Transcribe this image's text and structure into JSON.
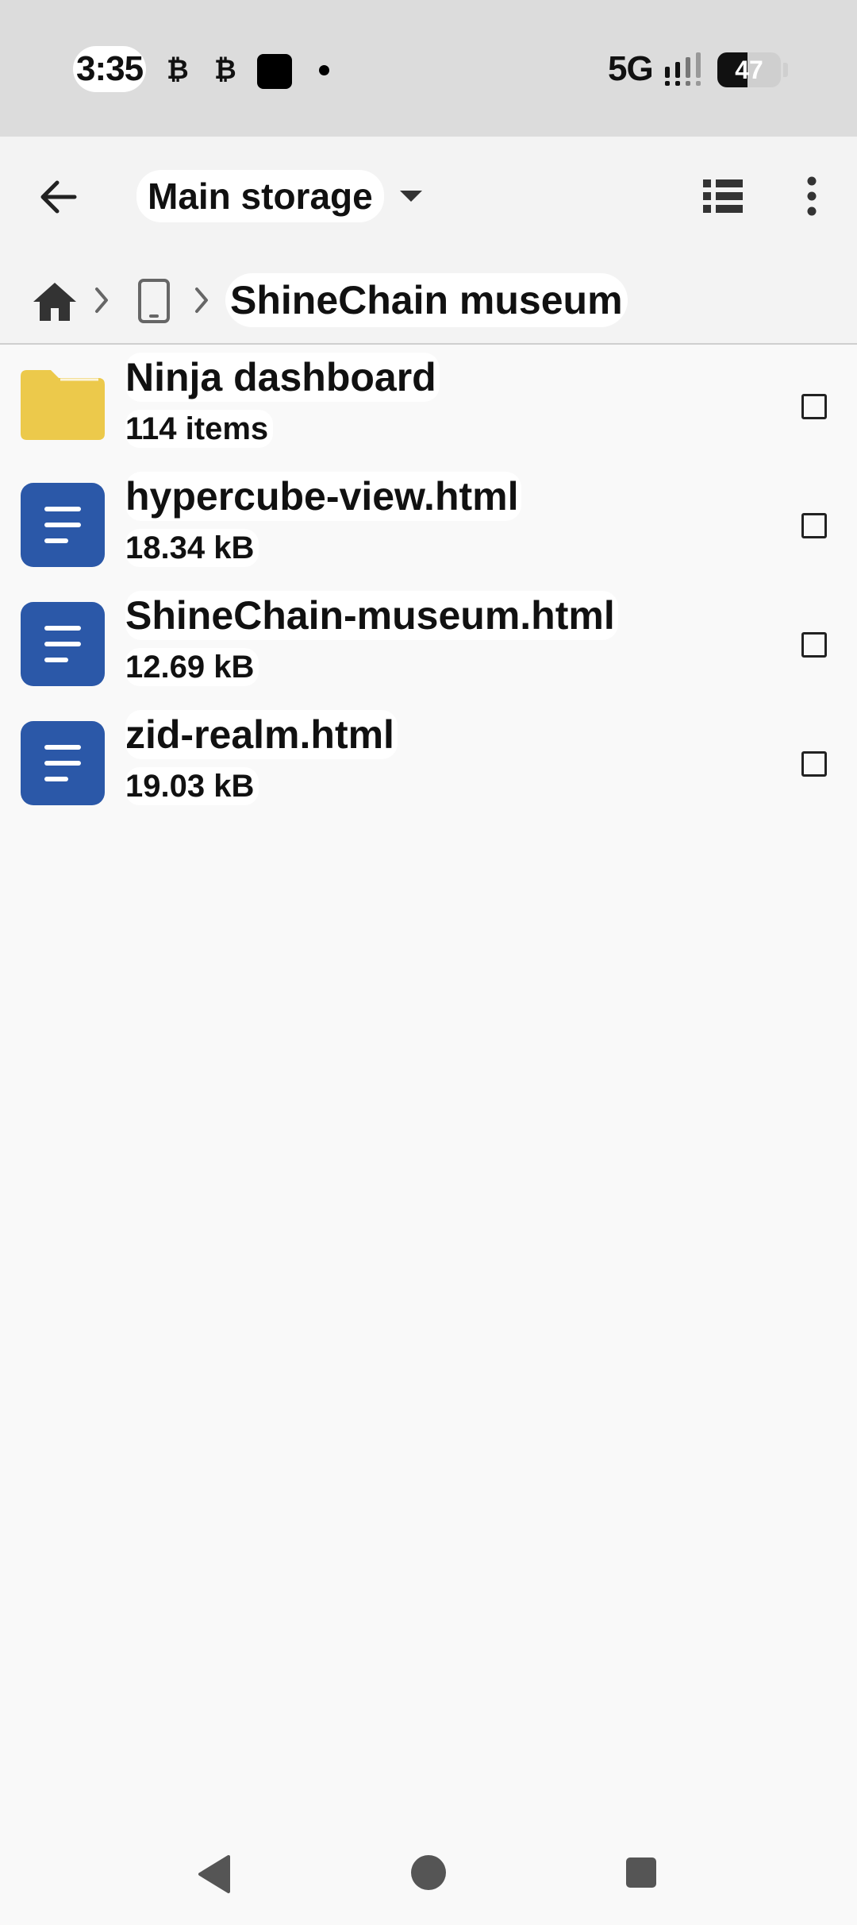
{
  "status_bar": {
    "time": "3:35",
    "notification_icons": [
      "bitcoin-icon",
      "bitcoin-icon",
      "app-square-icon",
      "dot-icon"
    ],
    "bitcoin_glyph": "₿",
    "network": "5G",
    "battery_level": "47",
    "battery_fraction": 0.47
  },
  "toolbar": {
    "title": "Main storage",
    "icons": [
      "arrow-back-icon",
      "dropdown-arrow-icon",
      "list-view-icon",
      "more-vert-icon"
    ]
  },
  "breadcrumb": {
    "icons": [
      "home-icon",
      "chevron-right-icon",
      "phone-device-icon",
      "chevron-right-icon"
    ],
    "current": "ShineChain museum"
  },
  "files": [
    {
      "name": "Ninja dashboard",
      "meta": "114 items",
      "type": "folder",
      "checked": false
    },
    {
      "name": "hypercube-view.html",
      "meta": "18.34 kB",
      "type": "document",
      "checked": false
    },
    {
      "name": "ShineChain-museum.html",
      "meta": "12.69 kB",
      "type": "document",
      "checked": false
    },
    {
      "name": "zid-realm.html",
      "meta": "19.03 kB",
      "type": "document",
      "checked": false
    }
  ],
  "colors": {
    "folder": "#ecc94b",
    "document": "#2b58a8",
    "status_bar_bg": "#dcdcdc",
    "app_bar_bg": "#f3f3f3",
    "list_bg": "#f9f9f9"
  },
  "nav_bar": {
    "icons": [
      "nav-back-icon",
      "nav-home-icon",
      "nav-recents-icon"
    ]
  }
}
